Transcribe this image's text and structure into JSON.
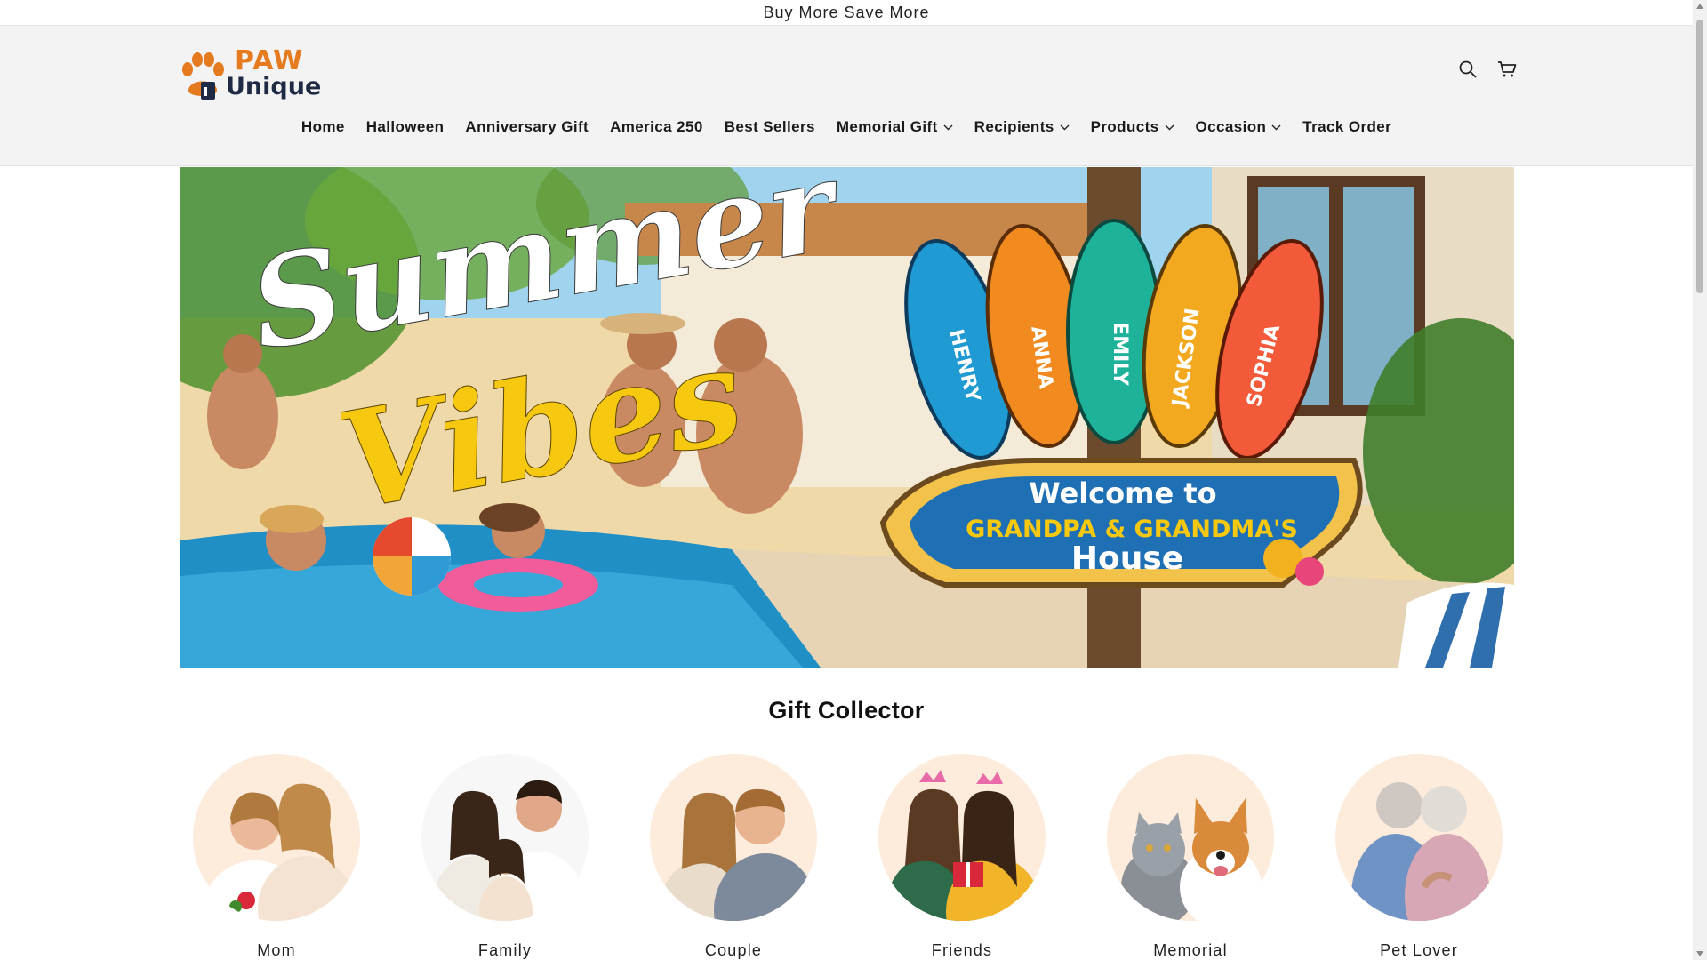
{
  "announcement": {
    "text": "Buy More Save More"
  },
  "logo": {
    "line1": "PAW",
    "line2": "Unique"
  },
  "header_icons": [
    {
      "name": "search-icon"
    },
    {
      "name": "cart-icon"
    }
  ],
  "nav": {
    "items": [
      {
        "label": "Home",
        "dropdown": false
      },
      {
        "label": "Halloween",
        "dropdown": false
      },
      {
        "label": "Anniversary Gift",
        "dropdown": false
      },
      {
        "label": "America 250",
        "dropdown": false
      },
      {
        "label": "Best Sellers",
        "dropdown": false
      },
      {
        "label": "Memorial Gift",
        "dropdown": true
      },
      {
        "label": "Recipients",
        "dropdown": true
      },
      {
        "label": "Products",
        "dropdown": true
      },
      {
        "label": "Occasion",
        "dropdown": true
      },
      {
        "label": "Track Order",
        "dropdown": false
      }
    ]
  },
  "hero": {
    "headline_1": "Summer",
    "headline_2": "Vibes",
    "sign_line1": "Welcome to",
    "sign_line2": "GRANDPA & GRANDMA'S",
    "sign_line3": "House",
    "names": [
      "HENRY",
      "ANNA",
      "EMILY",
      "JACKSON",
      "SOPHIA"
    ]
  },
  "gift_collector": {
    "title": "Gift Collector",
    "items": [
      {
        "label": "Mom"
      },
      {
        "label": "Family"
      },
      {
        "label": "Couple"
      },
      {
        "label": "Friends"
      },
      {
        "label": "Memorial"
      },
      {
        "label": "Pet Lover"
      }
    ]
  },
  "colors": {
    "brand_orange": "#e57a1f",
    "brand_navy": "#1f2a44",
    "header_bg": "#f3f3f3",
    "circle_bg": "#fdebdc"
  }
}
